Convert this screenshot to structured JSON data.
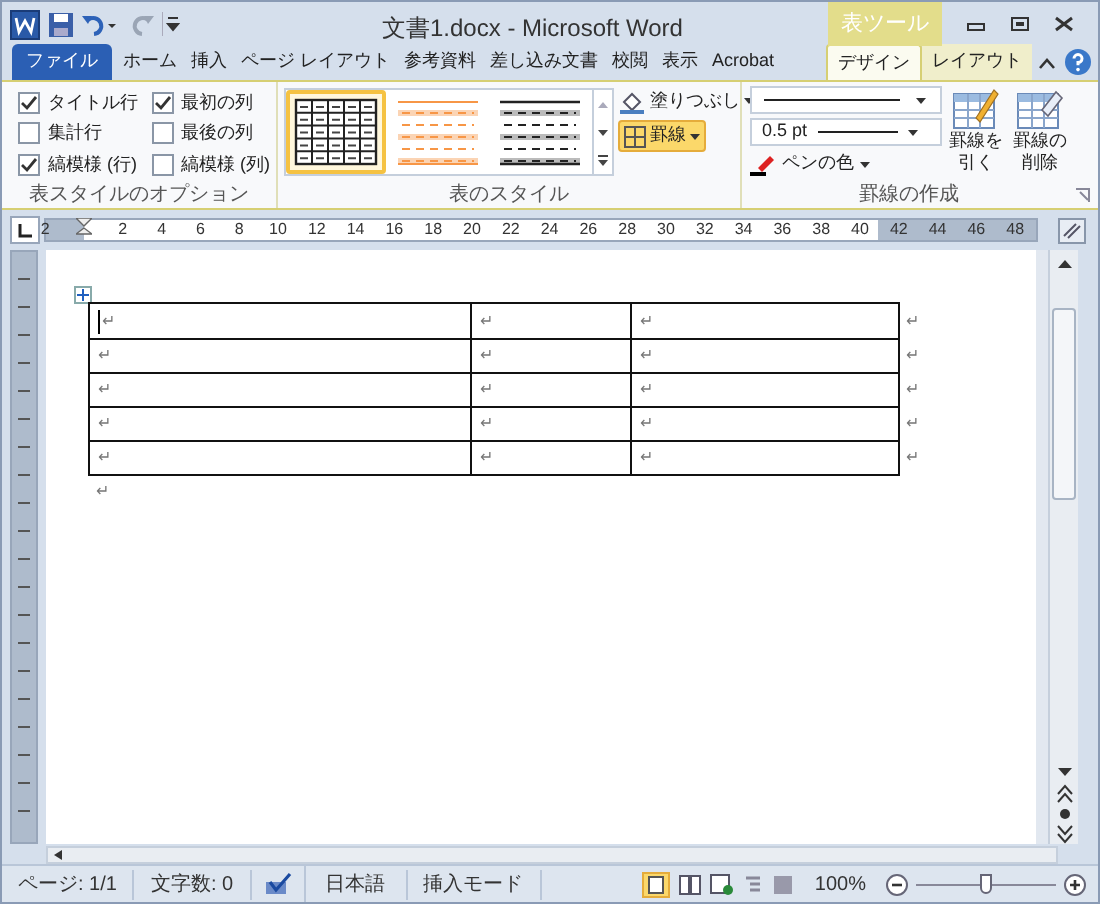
{
  "window": {
    "title": "文書1.docx - Microsoft Word",
    "context_group": "表ツール"
  },
  "tabs": [
    {
      "label": "ファイル",
      "kind": "file",
      "selected": false
    },
    {
      "label": "ホーム",
      "kind": "normal",
      "selected": false
    },
    {
      "label": "挿入",
      "kind": "normal",
      "selected": false
    },
    {
      "label": "ページ レイアウト",
      "kind": "normal",
      "selected": false
    },
    {
      "label": "参考資料",
      "kind": "normal",
      "selected": false
    },
    {
      "label": "差し込み文書",
      "kind": "normal",
      "selected": false
    },
    {
      "label": "校閲",
      "kind": "normal",
      "selected": false
    },
    {
      "label": "表示",
      "kind": "normal",
      "selected": false
    },
    {
      "label": "Acrobat",
      "kind": "normal",
      "selected": false
    },
    {
      "label": "デザイン",
      "kind": "context",
      "selected": true
    },
    {
      "label": "レイアウト",
      "kind": "context",
      "selected": false
    }
  ],
  "style_options": {
    "label": "表スタイルのオプション",
    "options": [
      {
        "label": "タイトル行",
        "checked": true
      },
      {
        "label": "集計行",
        "checked": false
      },
      {
        "label": "縞模様 (行)",
        "checked": true
      },
      {
        "label": "最初の列",
        "checked": true
      },
      {
        "label": "最後の列",
        "checked": false
      },
      {
        "label": "縞模様 (列)",
        "checked": false
      }
    ]
  },
  "table_styles": {
    "label": "表のスタイル",
    "styles": [
      {
        "kind": "grid",
        "selected": true
      },
      {
        "kind": "orange",
        "selected": false
      },
      {
        "kind": "gray",
        "selected": false
      }
    ],
    "shading": "塗りつぶし",
    "borders": {
      "label": "罫線",
      "selected": true
    }
  },
  "draw_borders": {
    "label": "罫線の作成",
    "line_weight": "0.5 pt",
    "pen_color": "ペンの色",
    "draw_button": [
      "罫線を",
      "引く"
    ],
    "erase_button": [
      "罫線の",
      "削除"
    ]
  },
  "ruler": {
    "numbers": [
      "2",
      "2",
      "4",
      "6",
      "8",
      "10",
      "12",
      "14",
      "16",
      "18",
      "20",
      "22",
      "24",
      "26",
      "28",
      "30",
      "32",
      "34",
      "36",
      "38",
      "40",
      "42",
      "44",
      "46",
      "48"
    ]
  },
  "table": {
    "rows": [
      {
        "cells": [
          {
            "text": "↵",
            "cursor": true
          },
          {
            "text": "↵",
            "cursor": false
          },
          {
            "text": "↵",
            "cursor": false
          }
        ],
        "end_mark": "↵"
      },
      {
        "cells": [
          {
            "text": "↵",
            "cursor": false
          },
          {
            "text": "↵",
            "cursor": false
          },
          {
            "text": "↵",
            "cursor": false
          }
        ],
        "end_mark": "↵"
      },
      {
        "cells": [
          {
            "text": "↵",
            "cursor": false
          },
          {
            "text": "↵",
            "cursor": false
          },
          {
            "text": "↵",
            "cursor": false
          }
        ],
        "end_mark": "↵"
      },
      {
        "cells": [
          {
            "text": "↵",
            "cursor": false
          },
          {
            "text": "↵",
            "cursor": false
          },
          {
            "text": "↵",
            "cursor": false
          }
        ],
        "end_mark": "↵"
      },
      {
        "cells": [
          {
            "text": "↵",
            "cursor": false
          },
          {
            "text": "↵",
            "cursor": false
          },
          {
            "text": "↵",
            "cursor": false
          }
        ],
        "end_mark": "↵"
      }
    ],
    "after_mark": "↵"
  },
  "status_bar": {
    "page": "ページ: 1/1",
    "words": "文字数: 0",
    "language": "日本語",
    "mode": "挿入モード",
    "zoom": "100%",
    "zoom_slider": {
      "level": 0.5
    }
  }
}
